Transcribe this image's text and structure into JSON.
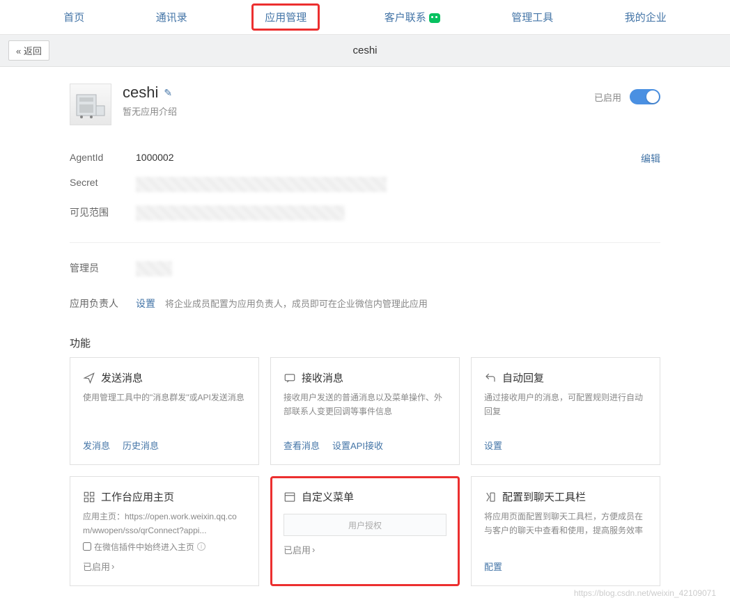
{
  "nav": {
    "items": [
      "首页",
      "通讯录",
      "应用管理",
      "客户联系",
      "管理工具",
      "我的企业"
    ],
    "highlighted_index": 2
  },
  "header": {
    "back": "« 返回",
    "title": "ceshi"
  },
  "app": {
    "name": "ceshi",
    "desc": "暂无应用介绍",
    "enabled_label": "已启用"
  },
  "info": {
    "agentid_label": "AgentId",
    "agentid_value": "1000002",
    "edit_label": "编辑",
    "secret_label": "Secret",
    "visible_label": "可见范围",
    "admin_label": "管理员",
    "owner_label": "应用负责人",
    "owner_setup": "设置",
    "owner_desc": "将企业成员配置为应用负责人，成员即可在企业微信内管理此应用"
  },
  "functions": {
    "title": "功能",
    "cards": [
      {
        "title": "发送消息",
        "desc": "使用管理工具中的\"消息群发\"或API发送消息",
        "actions": [
          "发消息",
          "历史消息"
        ]
      },
      {
        "title": "接收消息",
        "desc": "接收用户发送的普通消息以及菜单操作、外部联系人变更回调等事件信息",
        "actions": [
          "查看消息",
          "设置API接收"
        ]
      },
      {
        "title": "自动回复",
        "desc": "通过接收用户的消息，可配置规则进行自动回复",
        "actions": [
          "设置"
        ]
      },
      {
        "title": "工作台应用主页",
        "desc": "应用主页：https://open.work.weixin.qq.com/wwopen/sso/qrConnect?appi...",
        "checkbox_label": "在微信插件中始终进入主页",
        "status": "已启用"
      },
      {
        "title": "自定义菜单",
        "menu_preview": "用户授权",
        "status": "已启用"
      },
      {
        "title": "配置到聊天工具栏",
        "desc": "将应用页面配置到聊天工具栏，方便成员在与客户的聊天中查看和使用，提高服务效率",
        "actions": [
          "配置"
        ]
      }
    ]
  },
  "watermark": "https://blog.csdn.net/weixin_42109071"
}
